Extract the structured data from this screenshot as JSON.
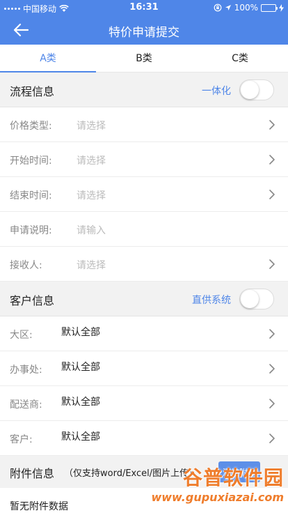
{
  "status_bar": {
    "carrier": "中国移动",
    "time": "16:31",
    "battery": "100%",
    "battery_level": 1.0
  },
  "navbar": {
    "title": "特价申请提交",
    "back_icon": "arrow-left-icon"
  },
  "tabs": [
    {
      "label": "A类",
      "active": true
    },
    {
      "label": "B类",
      "active": false
    },
    {
      "label": "C类",
      "active": false
    }
  ],
  "process_section": {
    "title": "流程信息",
    "toggle_label": "一体化",
    "toggle_on": false,
    "rows": [
      {
        "label": "价格类型:",
        "placeholder": "请选择",
        "has_chevron": true
      },
      {
        "label": "开始时间:",
        "placeholder": "请选择",
        "has_chevron": true
      },
      {
        "label": "结束时间:",
        "placeholder": "请选择",
        "has_chevron": true
      },
      {
        "label": "申请说明:",
        "placeholder": "请输入",
        "has_chevron": false
      },
      {
        "label": "接收人:",
        "placeholder": "请选择",
        "has_chevron": true
      }
    ]
  },
  "customer_section": {
    "title": "客户信息",
    "toggle_label": "直供系统",
    "toggle_on": false,
    "rows": [
      {
        "label": "大区:",
        "value": "默认全部"
      },
      {
        "label": "办事处:",
        "value": "默认全部"
      },
      {
        "label": "配送商:",
        "value": "默认全部"
      },
      {
        "label": "客户:",
        "value": "默认全部"
      }
    ]
  },
  "attachment_section": {
    "title": "附件信息",
    "note": "（仅支持word/Excel/图片上传）",
    "button_label": "添加附件",
    "empty_text": "暂无附件数据"
  },
  "watermark": {
    "text": "谷普软件园",
    "url": "www.gupuxiazai.com"
  },
  "colors": {
    "accent": "#4f86e8",
    "background": "#f2f2f2",
    "watermark": "#ef7d2c"
  }
}
